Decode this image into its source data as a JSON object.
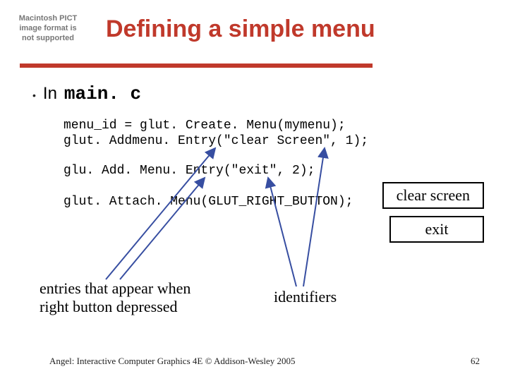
{
  "placeholder": "Macintosh PICT image format is not supported",
  "title": "Defining a simple menu",
  "bullet": {
    "in": "In",
    "file": "main. c"
  },
  "code": {
    "l1": "menu_id = glut. Create. Menu(mymenu);",
    "l2": "glut. Addmenu. Entry(\"clear Screen\", 1);",
    "l3": "glu. Add. Menu. Entry(\"exit\", 2);",
    "l4": "glut. Attach. Menu(GLUT_RIGHT_BUTTON);"
  },
  "menu_items": {
    "clear": "clear screen",
    "exit": "exit"
  },
  "captions": {
    "entries": "entries that appear when right button depressed",
    "identifiers": "identifiers"
  },
  "footer": "Angel: Interactive Computer Graphics 4E © Addison-Wesley 2005",
  "page": "62"
}
